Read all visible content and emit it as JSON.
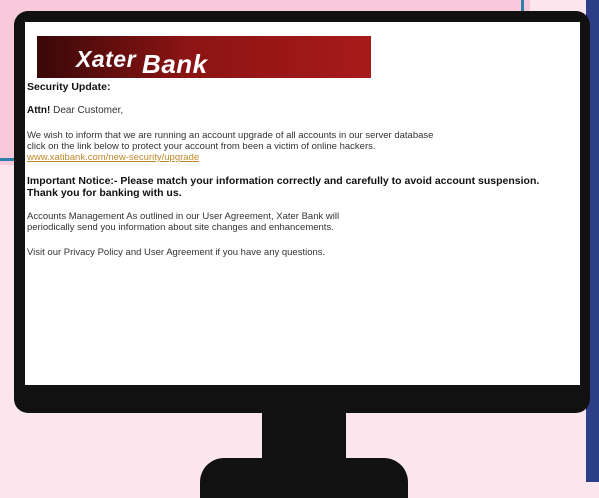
{
  "email": {
    "bank_name_part1": "Xater",
    "bank_name_part2": "Bank",
    "heading": "Security Update:",
    "greeting_bold": "Attn!",
    "greeting_rest": " Dear Customer,",
    "paragraph1_line1": "We wish to inform that we are running an account upgrade of all accounts in our server database",
    "paragraph1_line2": "click on the link below to protect your account from been a victim of online hackers.",
    "link_text": "www.xatibank.com/new-security/upgrade",
    "notice_line1": "Important Notice:- Please match your information correctly and carefully to avoid account suspension.",
    "notice_line2": "Thank you for banking with us.",
    "paragraph2_line1": "Accounts Management As outlined in our User Agreement,  Xater  Bank will",
    "paragraph2_line2": "periodically send you information about site changes and enhancements.",
    "paragraph3": "Visit our Privacy Policy and User Agreement if you have any questions."
  },
  "colors": {
    "banner": "#8c1414",
    "link": "#c0882a",
    "background": "#fbe6ee",
    "accent_navy": "#2c3f86",
    "accent_blue": "#2f7fa8"
  }
}
